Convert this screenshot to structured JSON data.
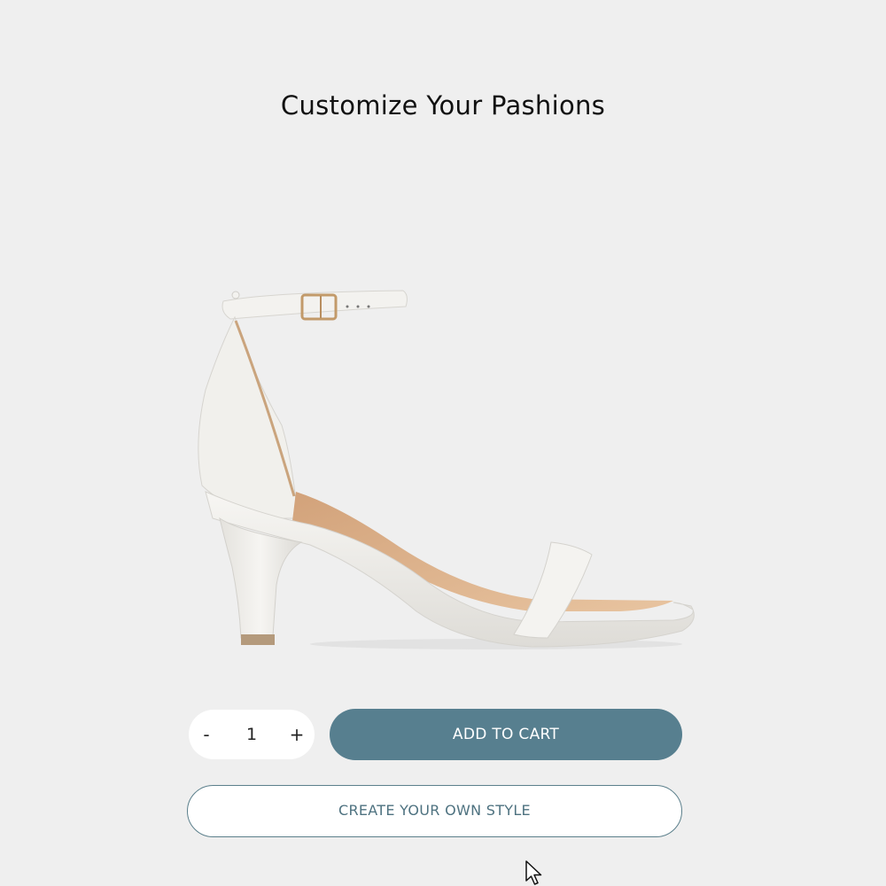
{
  "page": {
    "title": "Customize Your Pashions"
  },
  "product": {
    "image_subject": "white ankle-strap heeled sandal"
  },
  "quantity": {
    "decrement_label": "-",
    "value": "1",
    "increment_label": "+"
  },
  "actions": {
    "add_to_cart_label": "ADD TO CART",
    "create_style_label": "CREATE YOUR OWN STYLE"
  },
  "colors": {
    "background": "#efefef",
    "accent": "#577f8f",
    "outline": "#5b7f8b"
  }
}
